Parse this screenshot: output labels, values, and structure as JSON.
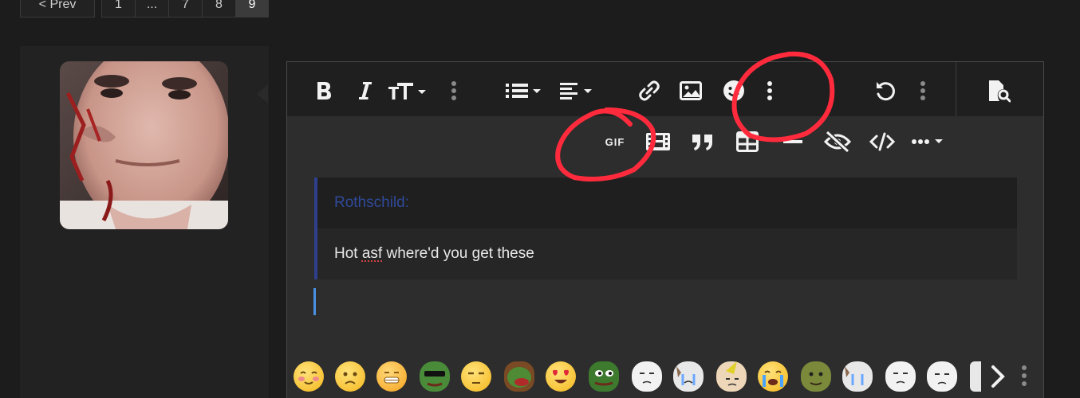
{
  "pagination": {
    "prev_label": "< Prev",
    "pages": [
      "1",
      "...",
      "7",
      "8",
      "9"
    ],
    "current": "9"
  },
  "user": {
    "avatar_alt": "user avatar"
  },
  "toolbar": {
    "row1": [
      "bold-icon",
      "italic-icon",
      "text-size-icon",
      "more-vertical-icon",
      "list-icon",
      "align-icon",
      "link-icon",
      "image-icon",
      "smiley-icon",
      "more-vertical-icon",
      "undo-icon",
      "more-vertical-icon",
      "preview-icon"
    ],
    "row2": [
      "gif-icon",
      "media-icon",
      "quote-icon",
      "table-icon",
      "horizontal-rule-icon",
      "spoiler-icon",
      "code-icon",
      "more-options-icon"
    ],
    "gif_label": "GIF"
  },
  "quote": {
    "author": "Rothschild:",
    "body_before": "Hot ",
    "body_misspelled": "asf",
    "body_after": " where'd you get these"
  },
  "emoji_bar": {
    "emojis": [
      "blushing-face",
      "worried-face",
      "grimacing-face",
      "pepe-sunglasses",
      "unamused-face",
      "pepe-angry",
      "heart-eyes-face",
      "pepe-frog",
      "wojak-face",
      "wojak-crying",
      "wojak-party-hat",
      "crying-face",
      "shrek-face",
      "wojak-crying-2",
      "wojak-face-2",
      "wojak-face-3",
      "wojak-partial"
    ],
    "next_icon": "chevron-right-icon",
    "more_icon": "more-vertical-icon"
  },
  "colors": {
    "annotation": "#ff2b3d",
    "quote_author": "#2f4a9a",
    "caret": "#4a90e2"
  }
}
